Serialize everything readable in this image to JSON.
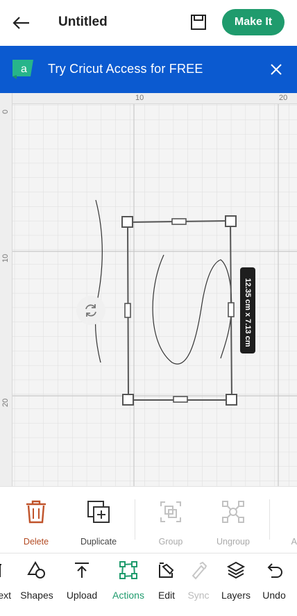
{
  "header": {
    "title": "Untitled",
    "make_it_label": "Make It",
    "accent": "#1f9b6d"
  },
  "banner": {
    "text": "Try Cricut Access for FREE",
    "logo_letter": "a",
    "color": "#0b5ad0"
  },
  "canvas": {
    "ruler_top_labels": [
      "10",
      "20"
    ],
    "ruler_left_labels": [
      "0",
      "10",
      "20"
    ],
    "dimension_label": "12.35 cm x 7.13 cm"
  },
  "actions": {
    "delete": "Delete",
    "duplicate": "Duplicate",
    "group": "Group",
    "ungroup": "Ungroup",
    "partial": "A"
  },
  "nav": {
    "text_partial": "ext",
    "shapes": "Shapes",
    "upload": "Upload",
    "actions": "Actions",
    "edit": "Edit",
    "sync": "Sync",
    "layers": "Layers",
    "undo": "Undo"
  }
}
